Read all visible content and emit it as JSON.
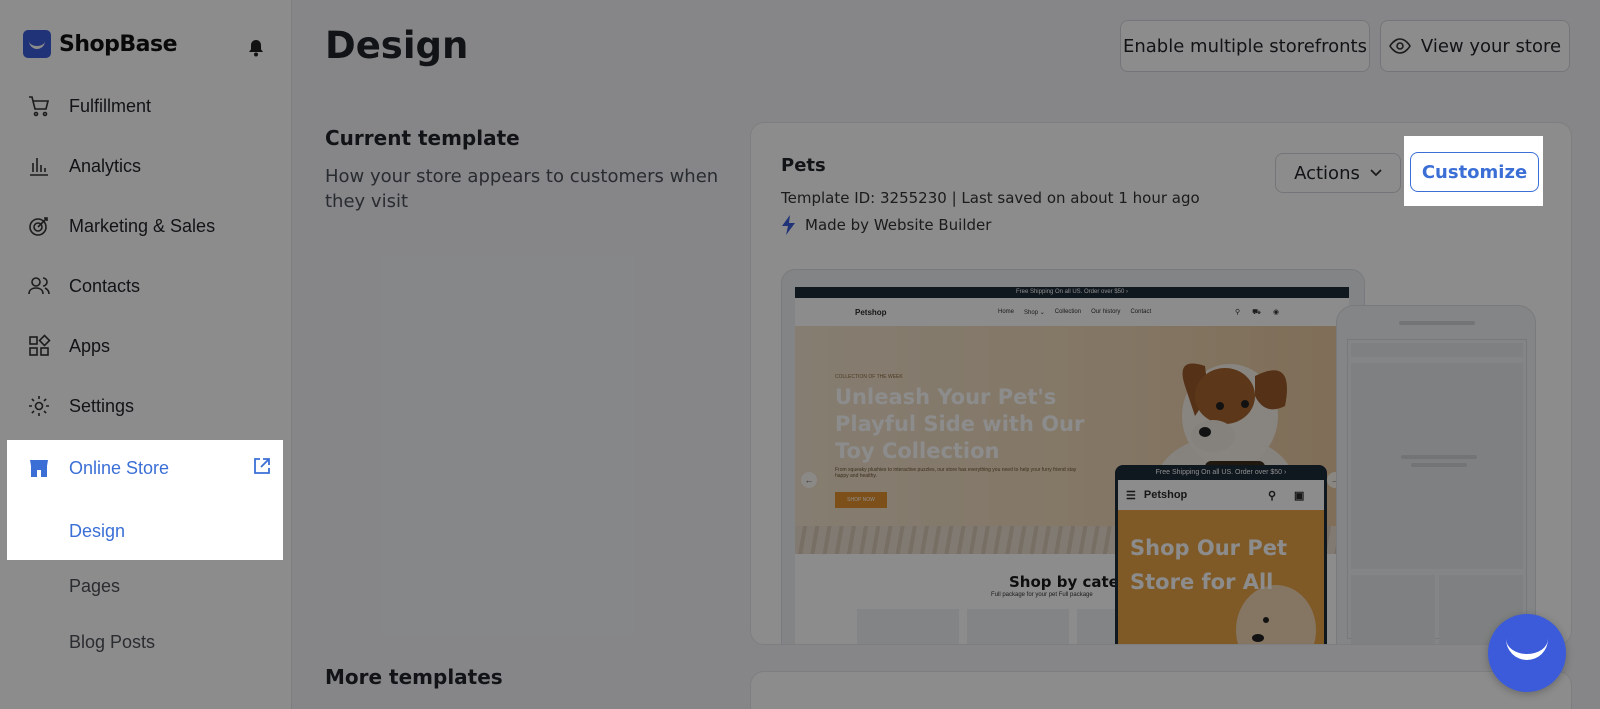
{
  "sidebar": {
    "brand": "ShopBase",
    "items": [
      {
        "label": "Fulfillment",
        "icon": "cart-icon"
      },
      {
        "label": "Analytics",
        "icon": "bar-chart-icon"
      },
      {
        "label": "Marketing & Sales",
        "icon": "target-icon"
      },
      {
        "label": "Contacts",
        "icon": "users-icon"
      },
      {
        "label": "Apps",
        "icon": "apps-grid-icon"
      },
      {
        "label": "Settings",
        "icon": "gear-icon"
      }
    ],
    "online_store": {
      "label": "Online Store",
      "icon": "store-icon",
      "external_icon": "external-link-icon"
    },
    "sub_items": [
      "Design",
      "Pages",
      "Blog Posts"
    ]
  },
  "header": {
    "title": "Design",
    "btn_multi": "Enable multiple storefronts",
    "btn_view": "View your store"
  },
  "current_template": {
    "section_title": "Current template",
    "section_desc": "How your store appears to customers when they visit",
    "name": "Pets",
    "meta": "Template ID: 3255230 | Last saved on about 1 hour ago",
    "made_by": "Made by Website Builder",
    "actions_label": "Actions",
    "customize_label": "Customize"
  },
  "preview": {
    "promo": "Free Shipping On all US. Order over $50 ›",
    "site_logo": "Petshop",
    "nav_links": [
      "Home",
      "Shop ⌄",
      "Collection",
      "Our history",
      "Contact"
    ],
    "hero_tag": "COLLECTION OF THE WEEK",
    "hero_title": "Unleash Your Pet's Playful Side with Our Toy Collection",
    "hero_sub": "From squeaky plushies to interactive puzzles, our store has everything you need to help your furry friend stay happy and healthy.",
    "hero_btn": "SHOP NOW",
    "shop_by": "Shop by catego",
    "shop_sub": "Full package for your pet Full package",
    "phone_promo": "Free Shipping On all US. Order over $50 ›",
    "phone_logo": "Petshop",
    "phone_title": "Shop Our Pet Store for All"
  },
  "more_templates": {
    "title": "More templates"
  },
  "colors": {
    "accent": "#3b6fd6",
    "brand": "#3b5bdb"
  }
}
